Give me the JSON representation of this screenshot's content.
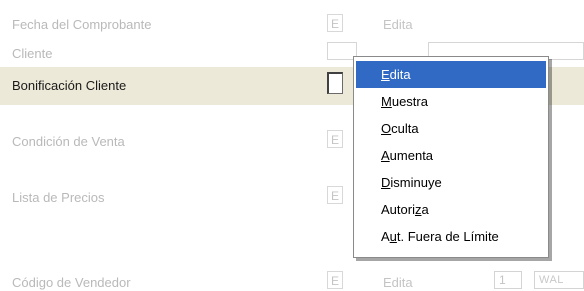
{
  "rows": [
    {
      "label": "Fecha del Comprobante",
      "mode_code": "E",
      "mode_text": "Edita",
      "state": "disabled"
    },
    {
      "label": "Cliente",
      "state": "disabled"
    },
    {
      "label": "Bonificación Cliente",
      "state": "enabled"
    },
    {
      "label": "Condición de Venta",
      "mode_code": "E",
      "state": "disabled"
    },
    {
      "label": "Lista de Precios",
      "mode_code": "E",
      "state": "disabled"
    },
    {
      "label": "Código de Vendedor",
      "mode_code": "E",
      "mode_text": "Edita",
      "number": "1",
      "code": "WAL",
      "state": "disabled"
    }
  ],
  "context_menu": {
    "selected_index": 0,
    "items": [
      {
        "before": "",
        "key": "E",
        "after": "dita"
      },
      {
        "before": "",
        "key": "M",
        "after": "uestra"
      },
      {
        "before": "",
        "key": "O",
        "after": "culta"
      },
      {
        "before": "",
        "key": "A",
        "after": "umenta"
      },
      {
        "before": "",
        "key": "D",
        "after": "isminuye"
      },
      {
        "before": "Autori",
        "key": "z",
        "after": "a"
      },
      {
        "before": "A",
        "key": "u",
        "after": "t. Fuera de Límite"
      }
    ]
  },
  "colors": {
    "selection": "#316ac5",
    "row_highlight": "#ece9d8",
    "disabled_text": "#b9b9b9"
  }
}
